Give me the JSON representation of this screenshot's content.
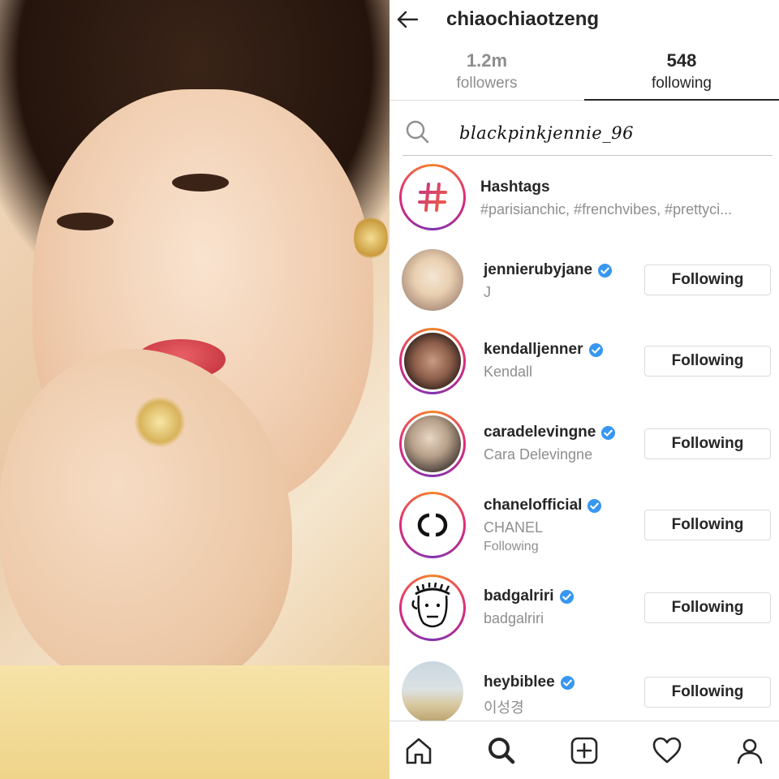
{
  "profile": {
    "username": "chiaochiaotzeng"
  },
  "tabs": {
    "followers": {
      "count": "1.2m",
      "label": "followers"
    },
    "following": {
      "count": "548",
      "label": "following"
    }
  },
  "search": {
    "value": "blackpinkjennie_96"
  },
  "hashtags": {
    "title": "Hashtags",
    "subtitle": "#parisianchic, #frenchvibes, #prettyci..."
  },
  "accounts": [
    {
      "username": "jennierubyjane",
      "subtitle": "J",
      "button": "Following"
    },
    {
      "username": "kendalljenner",
      "subtitle": "Kendall",
      "button": "Following"
    },
    {
      "username": "caradelevingne",
      "subtitle": "Cara Delevingne",
      "button": "Following"
    },
    {
      "username": "chanelofficial",
      "subtitle": "CHANEL",
      "extra": "Following",
      "button": "Following"
    },
    {
      "username": "badgalriri",
      "subtitle": "badgalriri",
      "button": "Following"
    },
    {
      "username": "heybiblee",
      "subtitle": "이성경",
      "button": "Following"
    }
  ],
  "nav": [
    "home-icon",
    "search-icon",
    "add-post-icon",
    "heart-icon",
    "profile-icon"
  ],
  "colors": {
    "verified": "#3897f0",
    "text": "#262626",
    "secondary": "#8e8e8e",
    "border": "#dbdbdb"
  }
}
